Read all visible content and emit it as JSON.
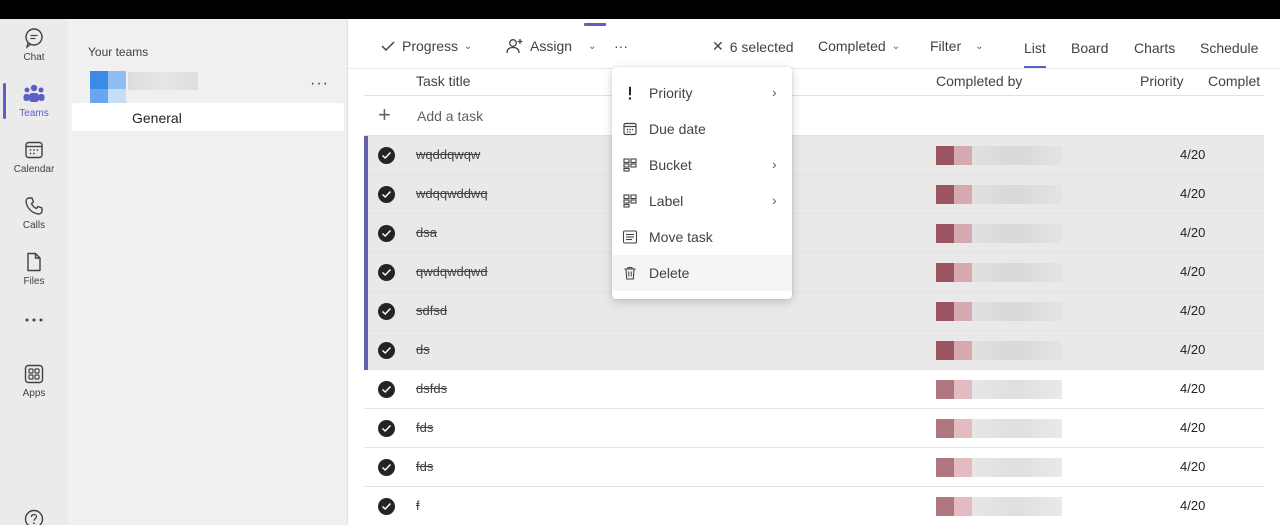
{
  "rail": {
    "items": [
      {
        "label": "Chat",
        "icon": "chat-icon"
      },
      {
        "label": "Teams",
        "icon": "teams-icon"
      },
      {
        "label": "Calendar",
        "icon": "calendar-icon"
      },
      {
        "label": "Calls",
        "icon": "phone-icon"
      },
      {
        "label": "Files",
        "icon": "file-icon"
      },
      {
        "label": "",
        "icon": "more-icon"
      },
      {
        "label": "Apps",
        "icon": "apps-icon"
      }
    ]
  },
  "teams_panel": {
    "heading": "Your teams",
    "more": "···",
    "channel": "General"
  },
  "toolbar": {
    "progress": "Progress",
    "assign": "Assign",
    "more": "···",
    "selected": "6 selected",
    "completed": "Completed",
    "filter": "Filter",
    "chevron": "⌄",
    "close": "✕"
  },
  "views": {
    "list": "List",
    "board": "Board",
    "charts": "Charts",
    "schedule": "Schedule"
  },
  "columns": {
    "task_title": "Task title",
    "completed_by": "Completed by",
    "priority": "Priority",
    "completed_date": "Complet"
  },
  "add_task": {
    "plus": "+",
    "label": "Add a task"
  },
  "tasks": [
    {
      "title": "wqddqwqw",
      "date": "4/20"
    },
    {
      "title": "wdqqwddwq",
      "date": "4/20"
    },
    {
      "title": "dsa",
      "date": "4/20"
    },
    {
      "title": "qwdqwdqwd",
      "date": "4/20"
    },
    {
      "title": "sdfsd",
      "date": "4/20"
    },
    {
      "title": "ds",
      "date": "4/20"
    },
    {
      "title": "dsfds",
      "date": "4/20"
    },
    {
      "title": "fds",
      "date": "4/20"
    },
    {
      "title": "fds",
      "date": "4/20"
    },
    {
      "title": "f",
      "date": "4/20"
    }
  ],
  "context_menu": {
    "items": [
      {
        "label": "Priority",
        "icon": "exclamation-icon",
        "has_submenu": true
      },
      {
        "label": "Due date",
        "icon": "calendar-icon",
        "has_submenu": false
      },
      {
        "label": "Bucket",
        "icon": "bucket-icon",
        "has_submenu": true
      },
      {
        "label": "Label",
        "icon": "label-icon",
        "has_submenu": true
      },
      {
        "label": "Move task",
        "icon": "move-icon",
        "has_submenu": false
      },
      {
        "label": "Delete",
        "icon": "trash-icon",
        "has_submenu": false
      }
    ],
    "submenu_glyph": "›"
  },
  "colors": {
    "accent": "#5b5fc7",
    "selection_bar": "#6264a7",
    "selected_row": "#e9e9e9"
  }
}
